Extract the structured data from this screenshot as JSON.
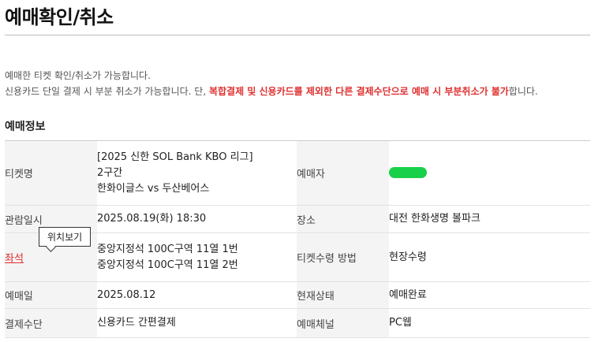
{
  "page": {
    "title": "예매확인/취소"
  },
  "notice": {
    "line1": "예매한 티켓 확인/취소가 가능합니다.",
    "line2_prefix": "신용카드 단일 결제 시 부분 취소가 가능합니다. 단, ",
    "line2_highlight": "복합결제 및 신용카드를 제외한 다른 결제수단으로 예매 시 부분취소가 불가",
    "line2_suffix": "합니다."
  },
  "section": {
    "title": "예매정보"
  },
  "info": {
    "ticket_label": "티켓명",
    "ticket_line1": "[2025 신한 SOL Bank KBO 리그]",
    "ticket_line2": "2구간",
    "ticket_line3": "한화이글스 vs 두산베어스",
    "booker_label": "예매자",
    "viewing_label": "관람일시",
    "viewing_value": "2025.08.19(화) 18:30",
    "venue_label": "장소",
    "venue_value": "대전 한화생명 볼파크",
    "seat_label": "좌석",
    "seat_tooltip": "위치보기",
    "seat_line1": "중앙지정석 100C구역 11열 1번",
    "seat_line2": "중앙지정석 100C구역 11열 2번",
    "receive_label": "티켓수령 방법",
    "receive_value": "현장수령",
    "booking_date_label": "예매일",
    "booking_date_value": "2025.08.12",
    "status_label": "현재상태",
    "status_value": "예매완료",
    "payment_label": "결제수단",
    "payment_value": "신용카드 간편결제",
    "channel_label": "예매체널",
    "channel_value": "PC웹"
  },
  "colors": {
    "accent_red": "#e03030",
    "redaction_green": "#19d04a",
    "label_bg": "#f4f4f4"
  }
}
